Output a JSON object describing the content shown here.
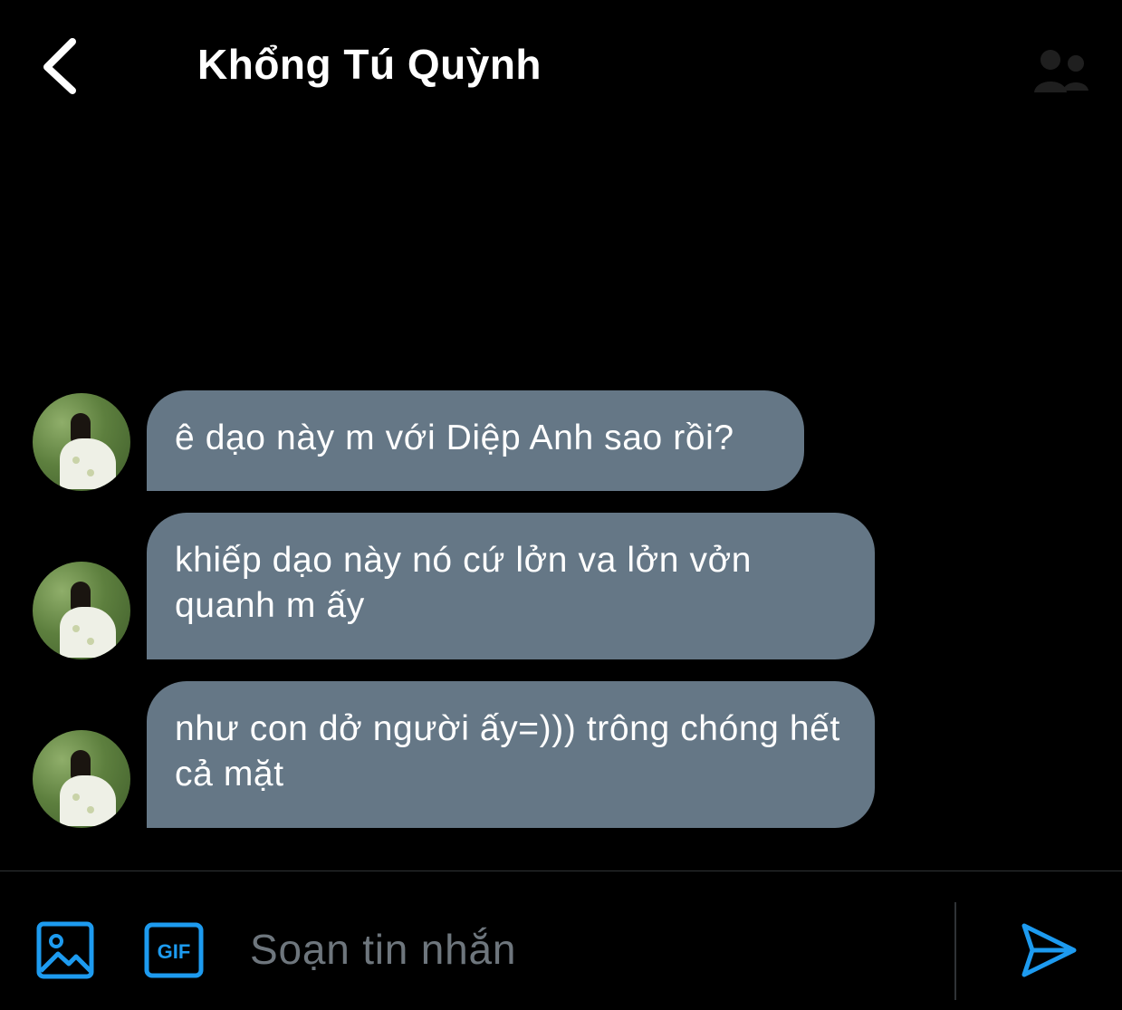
{
  "header": {
    "title": "Khổng Tú Quỳnh",
    "back_icon": "chevron-left-icon",
    "right_icon": "settings-icon"
  },
  "messages": [
    {
      "text": "ê dạo này m với Diệp Anh sao rồi?"
    },
    {
      "text": "khiếp dạo này nó cứ lởn va lởn vởn quanh m ấy"
    },
    {
      "text": "như con dở người ấy=))) trông chóng hết cả mặt"
    }
  ],
  "composer": {
    "placeholder": "Soạn tin nhắn",
    "media_icon": "image-icon",
    "gif_icon": "gif-icon",
    "gif_label": "GIF",
    "send_icon": "send-icon"
  },
  "colors": {
    "background": "#000000",
    "bubble": "#657786",
    "accent": "#1d9bf0",
    "placeholder": "#6e767d",
    "divider": "#2f3336"
  }
}
